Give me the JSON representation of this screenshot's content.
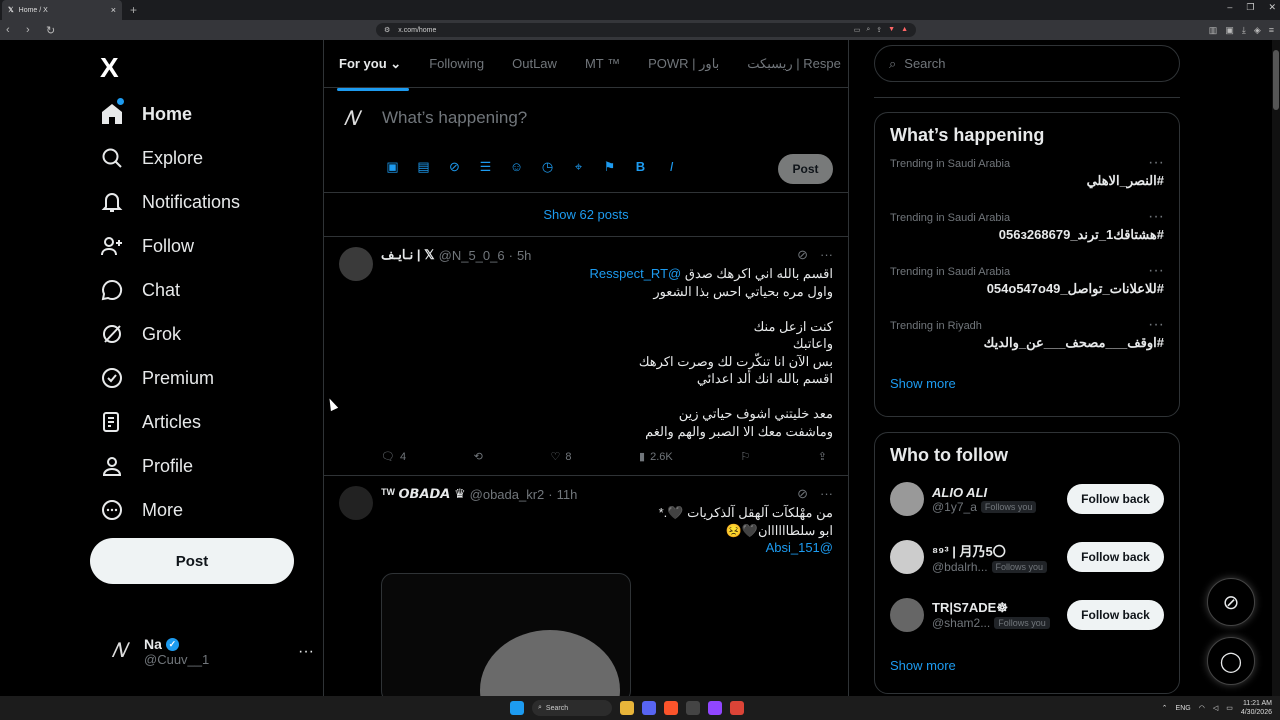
{
  "browser": {
    "tab_title": "Home / X",
    "tab_close": "×",
    "new_tab": "+",
    "url": "x.com/home",
    "win_min": "–",
    "win_max": "❐",
    "win_close": "✕"
  },
  "nav": {
    "logo": "X",
    "items": [
      {
        "label": "Home",
        "icon": "home-icon"
      },
      {
        "label": "Explore",
        "icon": "search-icon"
      },
      {
        "label": "Notifications",
        "icon": "bell-icon"
      },
      {
        "label": "Follow",
        "icon": "person-add-icon"
      },
      {
        "label": "Chat",
        "icon": "chat-bubble-icon"
      },
      {
        "label": "Grok",
        "icon": "grok-icon"
      },
      {
        "label": "Premium",
        "icon": "verified-icon"
      },
      {
        "label": "Articles",
        "icon": "article-icon"
      },
      {
        "label": "Profile",
        "icon": "person-icon"
      },
      {
        "label": "More",
        "icon": "more-circle-icon"
      }
    ],
    "post_button": "Post",
    "me": {
      "name": "Na",
      "handle": "@Cuuv__1",
      "more": "···"
    }
  },
  "feed": {
    "tabs": [
      "For you",
      "Following",
      "OutLaw",
      "MT ™",
      "POWR | باور",
      "ريسبكت | Respe"
    ],
    "composer": {
      "placeholder": "What’s happening?",
      "post": "Post"
    },
    "show_posts": "Show 62 posts",
    "tweets": [
      {
        "name": "نـايـف | 𝕏",
        "handle": "@N_5_0_6",
        "time": "5h",
        "mention": "@Resspect_RT",
        "line1": "اقسم بالله اني اكرهك صدق",
        "body": "واول مره بحياتي احس بذا الشعور\n\nكنت ازعل منك\nواعاتبك\nبس الآن انا تنكّرت لك وصرت اكرهك\nاقسم بالله انك ألد اعدائي\n\nمعد خليتني اشوف حياتي زين\nوماشفت معك الا الصبر والهم والغم",
        "replies": "4",
        "likes": "8",
        "views": "2.6K"
      },
      {
        "name": "ᵀᵂ 𝙊𝘽𝘼𝘿𝘼 ♛",
        "handle": "@obada_kr2",
        "time": "11h",
        "body": "من مهْلكآت آلهقل آلذكريات 🖤.*\nابو سلطاااااان🖤😣",
        "mention": "@Absi_151"
      }
    ]
  },
  "right": {
    "search_placeholder": "Search",
    "trending_title": "What’s happening",
    "trends": [
      {
        "context": "Trending in Saudi Arabia",
        "name": "#النصر_الاهلي"
      },
      {
        "context": "Trending in Saudi Arabia",
        "name": "#هشتاقك1_ترند_056з268679"
      },
      {
        "context": "Trending in Saudi Arabia",
        "name": "#للاعلانات_تواصل_054о547о49"
      },
      {
        "context": "Trending in Riyadh",
        "name": "#اوقف___مصحف___عن_والديك"
      }
    ],
    "show_more": "Show more",
    "who_title": "Who to follow",
    "follows": [
      {
        "name": "ALIO ALI",
        "handle": "@1y7_a",
        "badge": "Follows you",
        "button": "Follow back"
      },
      {
        "name": "⁸⁹³ | 月乃5〇",
        "handle": "@bdalrh...",
        "badge": "Follows you",
        "button": "Follow back"
      },
      {
        "name": "TR|S7ADE☸︎",
        "handle": "@sham2...",
        "badge": "Follows you",
        "button": "Follow back"
      }
    ],
    "show_more_2": "Show more"
  },
  "taskbar": {
    "search": "Search",
    "lang": "ENG",
    "time": "11:21 AM",
    "date": "4/30/2026"
  },
  "colors": {
    "accent": "#1d9bf0",
    "bg": "#000000",
    "border": "#2f3336",
    "muted": "#71767b"
  }
}
